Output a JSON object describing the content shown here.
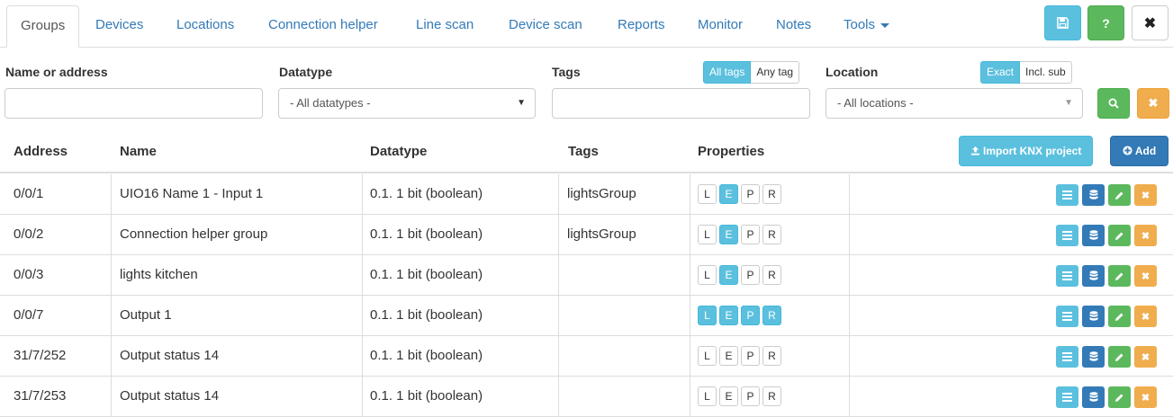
{
  "tabs": [
    {
      "label": "Groups",
      "active": true
    },
    {
      "label": "Devices"
    },
    {
      "label": "Locations"
    },
    {
      "label": "Connection helper"
    },
    {
      "label": "Line scan"
    },
    {
      "label": "Device scan"
    },
    {
      "label": "Reports"
    },
    {
      "label": "Monitor"
    },
    {
      "label": "Notes"
    },
    {
      "label": "Tools"
    }
  ],
  "top_buttons": {
    "save_icon": "floppy-disk-icon",
    "help_label": "?",
    "close_label": "✖"
  },
  "filters": {
    "name_label": "Name or address",
    "name_value": "",
    "datatype_label": "Datatype",
    "datatype_value": "- All datatypes -",
    "tags_label": "Tags",
    "tags_toggle": [
      "All tags",
      "Any tag"
    ],
    "tags_value": "",
    "location_label": "Location",
    "location_toggle": [
      "Exact",
      "Incl. sub"
    ],
    "location_value": "- All locations -"
  },
  "table": {
    "headers": [
      "Address",
      "Name",
      "Datatype",
      "Tags",
      "Properties"
    ],
    "import_label": "Import KNX project",
    "add_label": "Add",
    "rows": [
      {
        "address": "0/0/1",
        "name": "UIO16 Name 1 - Input 1",
        "datatype": "0.1. 1 bit (boolean)",
        "tags": "lightsGroup",
        "props": {
          "L": false,
          "E": true,
          "P": false,
          "R": false
        }
      },
      {
        "address": "0/0/2",
        "name": "Connection helper group",
        "datatype": "0.1. 1 bit (boolean)",
        "tags": "lightsGroup",
        "props": {
          "L": false,
          "E": true,
          "P": false,
          "R": false
        }
      },
      {
        "address": "0/0/3",
        "name": "lights kitchen",
        "datatype": "0.1. 1 bit (boolean)",
        "tags": "",
        "props": {
          "L": false,
          "E": true,
          "P": false,
          "R": false
        }
      },
      {
        "address": "0/0/7",
        "name": "Output 1",
        "datatype": "0.1. 1 bit (boolean)",
        "tags": "",
        "props": {
          "L": true,
          "E": true,
          "P": true,
          "R": true
        }
      },
      {
        "address": "31/7/252",
        "name": "Output status 14",
        "datatype": "0.1. 1 bit (boolean)",
        "tags": "",
        "props": {
          "L": false,
          "E": false,
          "P": false,
          "R": false
        }
      },
      {
        "address": "31/7/253",
        "name": "Output status 14",
        "datatype": "0.1. 1 bit (boolean)",
        "tags": "",
        "props": {
          "L": false,
          "E": false,
          "P": false,
          "R": false
        }
      }
    ]
  },
  "prop_letters": [
    "L",
    "E",
    "P",
    "R"
  ],
  "colors": {
    "info": "#5bc0de",
    "primary": "#337ab7",
    "success": "#5cb85c",
    "warning": "#f0ad4e",
    "link": "#337ab7"
  }
}
